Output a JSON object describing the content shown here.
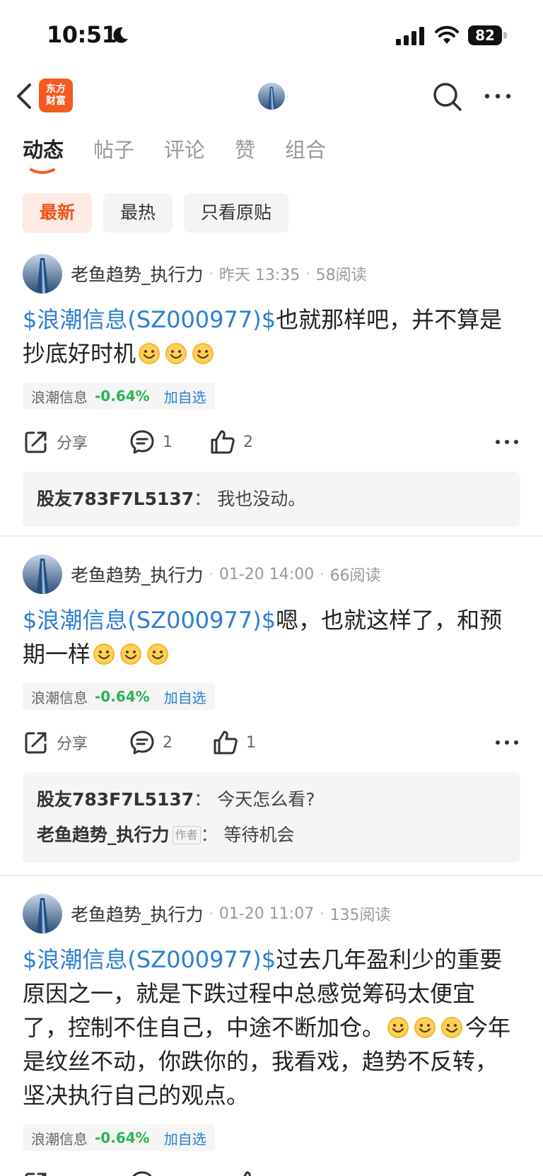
{
  "status_bar": {
    "time": "10:51",
    "battery": "82"
  },
  "nav": {
    "logo_line1": "东方",
    "logo_line2": "财富"
  },
  "tabs": [
    {
      "label": "动态"
    },
    {
      "label": "帖子"
    },
    {
      "label": "评论"
    },
    {
      "label": "赞"
    },
    {
      "label": "组合"
    }
  ],
  "filters": [
    {
      "label": "最新"
    },
    {
      "label": "最热"
    },
    {
      "label": "只看原贴"
    }
  ],
  "posts": [
    {
      "author": "老鱼趋势_执行力",
      "time": "昨天 13:35",
      "reads": "58阅读",
      "stock_tag": "$浪潮信息(SZ000977)$",
      "text": "也就那样吧，并不算是抄底好时机",
      "text_after": "",
      "stock_name": "浪潮信息",
      "stock_change": "-0.64%",
      "add_watch": "加自选",
      "share": "分享",
      "comment_count": "1",
      "like_count": "2",
      "comments": [
        {
          "user": "股友783F7L5137",
          "text": "我也没动。"
        }
      ]
    },
    {
      "author": "老鱼趋势_执行力",
      "time": "01-20 14:00",
      "reads": "66阅读",
      "stock_tag": "$浪潮信息(SZ000977)$",
      "text": "嗯，也就这样了，和预期一样",
      "text_after": "",
      "stock_name": "浪潮信息",
      "stock_change": "-0.64%",
      "add_watch": "加自选",
      "share": "分享",
      "comment_count": "2",
      "like_count": "1",
      "comments": [
        {
          "user": "股友783F7L5137",
          "text": "今天怎么看?"
        },
        {
          "user": "老鱼趋势_执行力",
          "badge": "作者",
          "text": "等待机会"
        }
      ]
    },
    {
      "author": "老鱼趋势_执行力",
      "time": "01-20 11:07",
      "reads": "135阅读",
      "stock_tag": "$浪潮信息(SZ000977)$",
      "text": "过去几年盈利少的重要原因之一，就是下跌过程中总感觉筹码太便宜了，控制不住自己，中途不断加仓。",
      "text_after": "今年是纹丝不动，你跌你的，我看戏，趋势不反转，坚决执行自己的观点。",
      "stock_name": "浪潮信息",
      "stock_change": "-0.64%",
      "add_watch": "加自选"
    }
  ],
  "colors": {
    "brand": "#f35a21",
    "stock_link": "#2a7fd4",
    "down_green": "#2ab457"
  }
}
